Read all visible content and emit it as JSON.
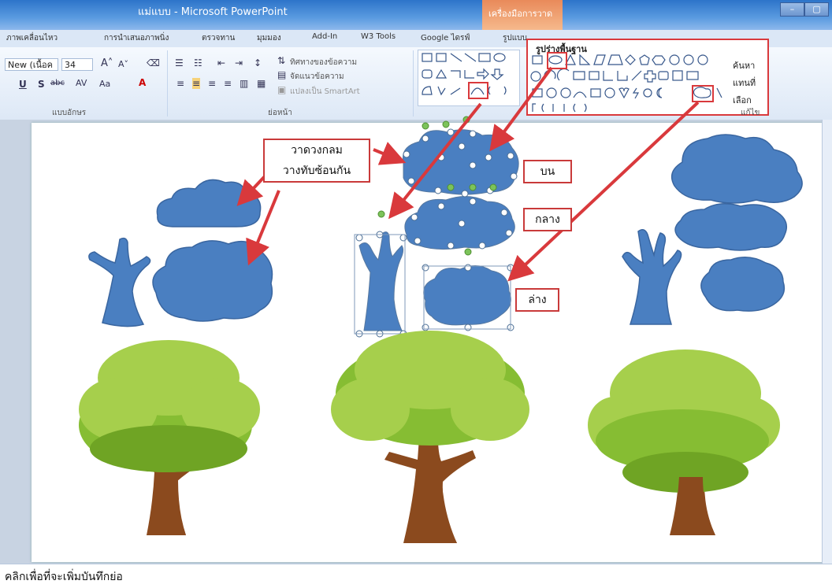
{
  "window": {
    "title": "แม่แบบ - Microsoft PowerPoint",
    "context_tab": "เครื่องมือการวาด",
    "buttons": [
      "–",
      "▢"
    ]
  },
  "tabs": [
    "ภาพเคลื่อนไหว",
    "การนำเสนอภาพนิ่ง",
    "ตรวจทาน",
    "มุมมอง",
    "Add-In",
    "W3 Tools",
    "Google ไดรฟ์",
    "รูปแบบ"
  ],
  "ribbon": {
    "font": {
      "name": "New (เนื้อค",
      "size": "34",
      "group_label": "แบบอักษร"
    },
    "paragraph": {
      "text_direction": "ทิศทางของข้อความ",
      "align_text": "จัดแนวข้อความ",
      "convert_smartart": "แปลงเป็น SmartArt",
      "group_label": "ย่อหน้า"
    },
    "shapes_popup": {
      "title": "รูปร่างพื้นฐาน"
    },
    "editing": {
      "find": "ค้นหา",
      "replace": "แทนที่",
      "select": "เลือก",
      "group_label": "แก้ไข"
    }
  },
  "slide": {
    "callouts": [
      {
        "text": "วาดวงกลม"
      },
      {
        "text": "วางทับซ้อนกัน"
      },
      {
        "text": "บน"
      },
      {
        "text": "กลาง"
      },
      {
        "text": "ล่าง"
      }
    ]
  },
  "notes": {
    "placeholder": "คลิกเพื่อที่จะเพิ่มบันทึกย่อ"
  },
  "colors": {
    "cloud_blue": "#4a7fc1",
    "cloud_stroke": "#3a66a0",
    "leaf_dark": "#6fa424",
    "leaf_mid": "#86bd33",
    "leaf_light": "#a6cf4c",
    "trunk": "#8b4a1e",
    "highlight_red": "#d9393c",
    "title_bar": "#2d74c9"
  }
}
